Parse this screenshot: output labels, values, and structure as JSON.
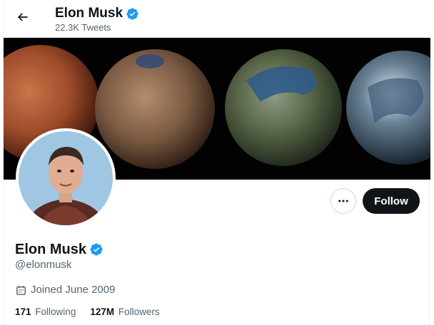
{
  "header": {
    "back_icon": "arrow-left-icon",
    "name": "Elon Musk",
    "tweet_count": "22.3K Tweets",
    "verified_icon": "verified-badge-icon"
  },
  "banner": {
    "description_icon": "planet-banner-image"
  },
  "actions": {
    "more_icon": "more-horizontal-icon",
    "follow_label": "Follow"
  },
  "profile": {
    "name": "Elon Musk",
    "handle": "@elonmusk",
    "joined": "Joined June 2009",
    "calendar_icon": "calendar-icon",
    "following_count": "171",
    "following_label": "Following",
    "followers_count": "127M",
    "followers_label": "Followers"
  },
  "colors": {
    "verified": "#1d9bf0",
    "follow_bg": "#0f1419",
    "secondary_text": "#536471"
  }
}
